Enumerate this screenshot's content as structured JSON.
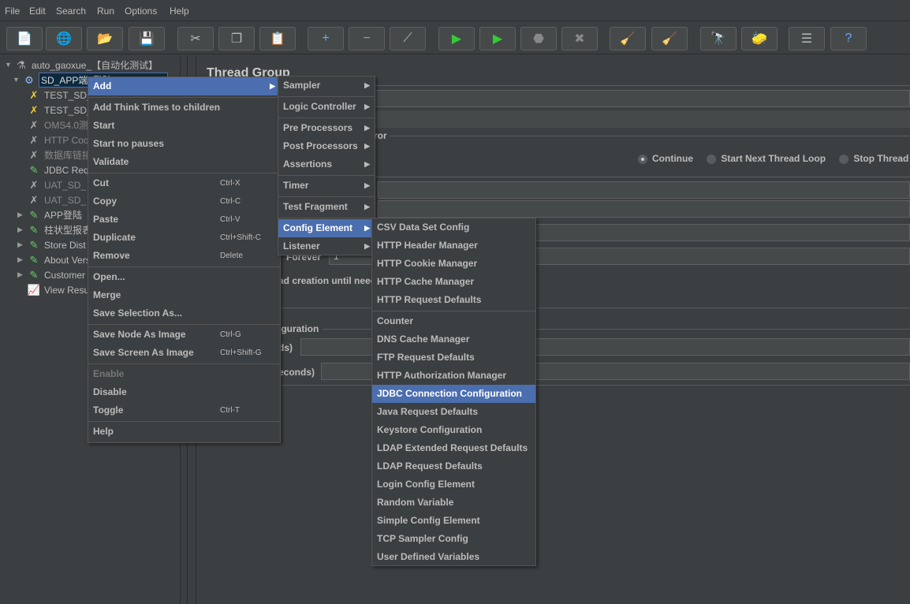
{
  "menubar": [
    "File",
    "Edit",
    "Search",
    "Run",
    "Options",
    "Help"
  ],
  "toolbar": [
    {
      "icon": "new-icon",
      "g": "📄"
    },
    {
      "icon": "templates-icon",
      "g": "🌐"
    },
    {
      "icon": "open-icon",
      "g": "📂"
    },
    {
      "icon": "save-icon",
      "g": "💾"
    },
    {
      "icon": "cut-icon",
      "g": "✂"
    },
    {
      "icon": "copy-icon",
      "g": "❐"
    },
    {
      "icon": "paste-icon",
      "g": "📋"
    },
    {
      "icon": "expand-icon",
      "g": "+"
    },
    {
      "icon": "collapse-icon",
      "g": "−"
    },
    {
      "icon": "toggle-icon",
      "g": "⟋"
    },
    {
      "icon": "start-icon",
      "g": "▶"
    },
    {
      "icon": "start-no-pauses-icon",
      "g": "▶"
    },
    {
      "icon": "stop-icon",
      "g": "⬣"
    },
    {
      "icon": "shutdown-icon",
      "g": "✖"
    },
    {
      "icon": "clear-icon",
      "g": "🧹"
    },
    {
      "icon": "clear-all-icon",
      "g": "🧹"
    },
    {
      "icon": "search-icon",
      "g": "🔭"
    },
    {
      "icon": "reset-search-icon",
      "g": "🧽"
    },
    {
      "icon": "function-helper-icon",
      "g": "☰"
    },
    {
      "icon": "help-icon",
      "g": "?"
    }
  ],
  "tree": [
    {
      "label": "auto_gaoxue_【自动化测试】",
      "icon": "test-plan-icon",
      "g": "⚗",
      "level": 0,
      "tw": "▼"
    },
    {
      "label": "SD_APP端_登陆_TEST(UAT)",
      "icon": "thread-group-icon",
      "g": "⚙",
      "level": 1,
      "tw": "▼",
      "selected": true
    },
    {
      "label": "TEST_SD_",
      "icon": "config-element-icon",
      "g": "✗",
      "level": 2
    },
    {
      "label": "TEST_SD_",
      "icon": "config-element-icon",
      "g": "✗",
      "level": 2
    },
    {
      "label": "OMS4.0测",
      "icon": "config-element-disabled-icon",
      "g": "✗",
      "level": 2,
      "disabled": true
    },
    {
      "label": "HTTP Coo",
      "icon": "config-element-disabled-icon",
      "g": "✗",
      "level": 2,
      "disabled": true
    },
    {
      "label": "数据库链接",
      "icon": "config-element-disabled-icon",
      "g": "✗",
      "level": 2,
      "disabled": true
    },
    {
      "label": "JDBC Req",
      "icon": "sampler-icon",
      "g": "✎",
      "level": 2
    },
    {
      "label": "UAT_SD_",
      "icon": "config-element-disabled-icon",
      "g": "✗",
      "level": 2,
      "disabled": true
    },
    {
      "label": "UAT_SD_",
      "icon": "config-element-disabled-icon",
      "g": "✗",
      "level": 2,
      "disabled": true
    },
    {
      "label": "APP登陆",
      "icon": "sampler-icon",
      "g": "✎",
      "level": 2,
      "tw": "▶"
    },
    {
      "label": "柱状型报表",
      "icon": "sampler-icon",
      "g": "✎",
      "level": 2,
      "tw": "▶"
    },
    {
      "label": "Store Dist",
      "icon": "sampler-icon",
      "g": "✎",
      "level": 2,
      "tw": "▶"
    },
    {
      "label": "About Vers",
      "icon": "sampler-icon",
      "g": "✎",
      "level": 2,
      "tw": "▶"
    },
    {
      "label": "Customer",
      "icon": "sampler-icon",
      "g": "✎",
      "level": 2,
      "tw": "▶"
    },
    {
      "label": "View Resu",
      "icon": "listener-icon",
      "g": "📈",
      "level": 2
    }
  ],
  "main": {
    "title": "Thread Group",
    "error_group": "ror",
    "radios": [
      {
        "label": "Continue",
        "on": true
      },
      {
        "label": "Start Next Thread Loop",
        "on": false
      },
      {
        "label": "Stop Thread",
        "on": false
      }
    ],
    "forever": "Forever",
    "loop_value": "1",
    "delay_label": "ad creation until need",
    "sched_group": "iguration",
    "duration_label": "ds)",
    "startup_label": "econds)"
  },
  "context_menu": [
    {
      "label": "Add",
      "arrow": true,
      "sel": true
    },
    {
      "sep": true
    },
    {
      "label": "Add Think Times to children"
    },
    {
      "label": "Start"
    },
    {
      "label": "Start no pauses"
    },
    {
      "label": "Validate"
    },
    {
      "sep": true
    },
    {
      "label": "Cut",
      "sc": "Ctrl-X"
    },
    {
      "label": "Copy",
      "sc": "Ctrl-C"
    },
    {
      "label": "Paste",
      "sc": "Ctrl-V"
    },
    {
      "label": "Duplicate",
      "sc": "Ctrl+Shift-C"
    },
    {
      "label": "Remove",
      "sc": "Delete"
    },
    {
      "sep": true
    },
    {
      "label": "Open..."
    },
    {
      "label": "Merge"
    },
    {
      "label": "Save Selection As..."
    },
    {
      "sep": true
    },
    {
      "label": "Save Node As Image",
      "sc": "Ctrl-G"
    },
    {
      "label": "Save Screen As Image",
      "sc": "Ctrl+Shift-G"
    },
    {
      "sep": true
    },
    {
      "label": "Enable",
      "dis": true
    },
    {
      "label": "Disable"
    },
    {
      "label": "Toggle",
      "sc": "Ctrl-T"
    },
    {
      "sep": true
    },
    {
      "label": "Help"
    }
  ],
  "add_menu": [
    {
      "label": "Sampler",
      "arrow": true
    },
    {
      "sep": true
    },
    {
      "label": "Logic Controller",
      "arrow": true
    },
    {
      "sep": true
    },
    {
      "label": "Pre Processors",
      "arrow": true
    },
    {
      "label": "Post Processors",
      "arrow": true
    },
    {
      "label": "Assertions",
      "arrow": true
    },
    {
      "sep": true
    },
    {
      "label": "Timer",
      "arrow": true
    },
    {
      "sep": true
    },
    {
      "label": "Test Fragment",
      "arrow": true
    },
    {
      "sep": true
    },
    {
      "label": "Config Element",
      "arrow": true,
      "sel": true
    },
    {
      "label": "Listener",
      "arrow": true
    }
  ],
  "config_menu": [
    {
      "label": "CSV Data Set Config"
    },
    {
      "label": "HTTP Header Manager"
    },
    {
      "label": "HTTP Cookie Manager"
    },
    {
      "label": "HTTP Cache Manager"
    },
    {
      "label": "HTTP Request Defaults"
    },
    {
      "sep": true
    },
    {
      "label": "Counter"
    },
    {
      "label": "DNS Cache Manager"
    },
    {
      "label": "FTP Request Defaults"
    },
    {
      "label": "HTTP Authorization Manager"
    },
    {
      "label": "JDBC Connection Configuration",
      "sel": true
    },
    {
      "label": "Java Request Defaults"
    },
    {
      "label": "Keystore Configuration"
    },
    {
      "label": "LDAP Extended Request Defaults"
    },
    {
      "label": "LDAP Request Defaults"
    },
    {
      "label": "Login Config Element"
    },
    {
      "label": "Random Variable"
    },
    {
      "label": "Simple Config Element"
    },
    {
      "label": "TCP Sampler Config"
    },
    {
      "label": "User Defined Variables"
    }
  ],
  "colors": {
    "selection": "#4b6eaf",
    "background": "#3c3f41"
  }
}
